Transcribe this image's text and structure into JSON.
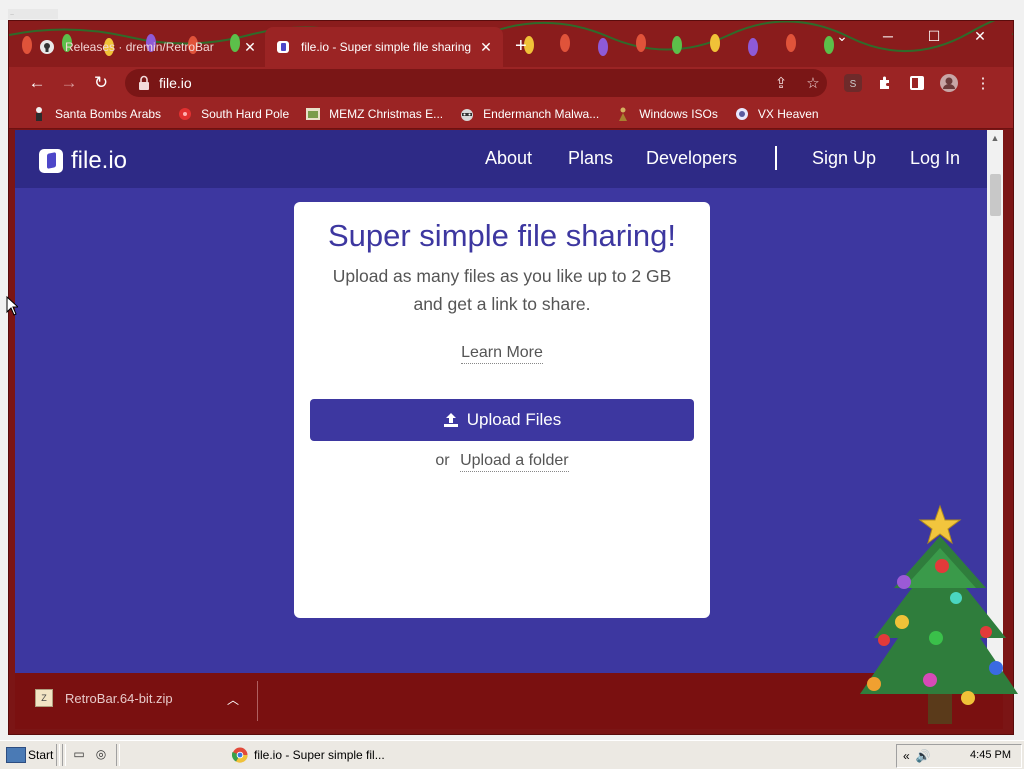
{
  "browser": {
    "tabs": [
      {
        "title": "Releases · dremin/RetroBar",
        "icon": "github-icon",
        "active": false
      },
      {
        "title": "file.io - Super simple file sharing",
        "icon": "fileio-favicon",
        "active": true
      }
    ],
    "address": "file.io",
    "bookmarks": [
      {
        "label": "Santa Bombs Arabs",
        "icon": "santa-icon"
      },
      {
        "label": "South Hard Pole",
        "icon": "red-flower-icon"
      },
      {
        "label": "MEMZ Christmas E...",
        "icon": "image-icon"
      },
      {
        "label": "Endermanch Malwa...",
        "icon": "raccoon-icon"
      },
      {
        "label": "Windows ISOs",
        "icon": "figure-icon"
      },
      {
        "label": "VX Heaven",
        "icon": "blob-icon"
      }
    ],
    "profile_badge": "S"
  },
  "site": {
    "logo": "file.io",
    "nav": {
      "about": "About",
      "plans": "Plans",
      "developers": "Developers",
      "signup": "Sign Up",
      "login": "Log In"
    },
    "hero": {
      "title": "Super simple file sharing!",
      "subtitle_line1": "Upload as many files as you like up to 2 GB",
      "subtitle_line2": "and get a link to share.",
      "learn_more": "Learn More",
      "upload_button": "Upload Files",
      "or": "or",
      "upload_folder": "Upload a folder"
    }
  },
  "downloads": {
    "file": "RetroBar.64-bit.zip"
  },
  "taskbar": {
    "start": "Start",
    "task": "file.io - Super simple fil...",
    "clock": "4:45 PM"
  },
  "colors": {
    "page_bg": "#3d37a0",
    "nav_bg": "#2e2a86",
    "browser_frame": "#9b2424",
    "download_shelf": "#7a1010"
  }
}
